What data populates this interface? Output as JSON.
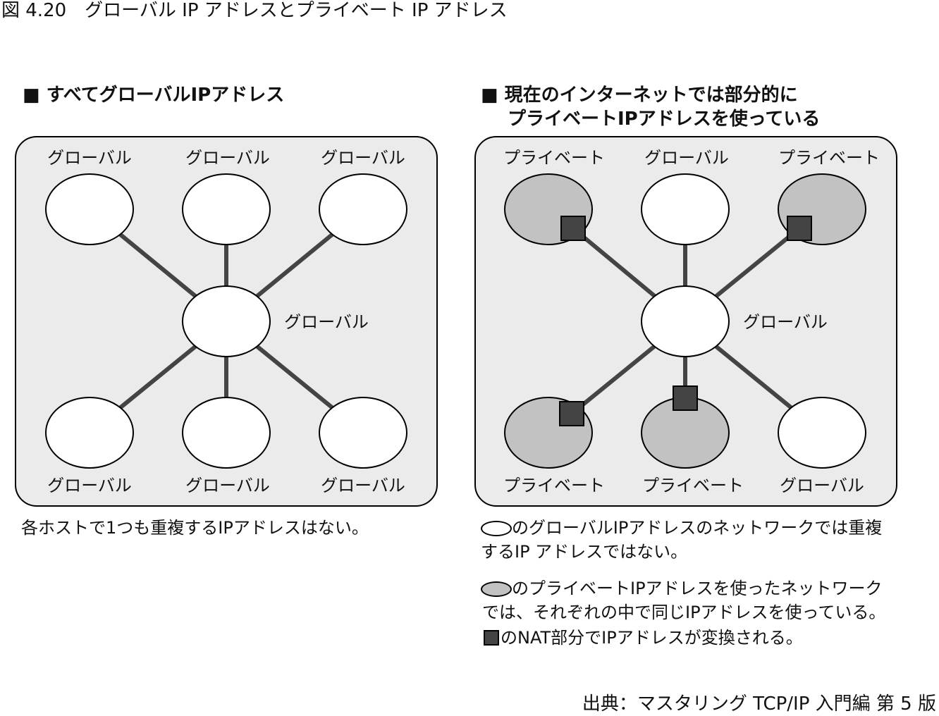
{
  "figure_title": "図 4.20　グローバル IP アドレスとプライベート IP アドレス",
  "left_panel": {
    "heading": "■ すべてグローバルIPアドレス",
    "hub_label": "グローバル",
    "top_labels": [
      "グローバル",
      "グローバル",
      "グローバル"
    ],
    "bottom_labels": [
      "グローバル",
      "グローバル",
      "グローバル"
    ],
    "note": "各ホストで1つも重複するIPアドレスはない。"
  },
  "right_panel": {
    "heading_line1": "■ 現在のインターネットでは部分的に",
    "heading_line2": "プライベートIPアドレスを使っている",
    "hub_label": "グローバル",
    "top_labels": [
      "プライベート",
      "グローバル",
      "プライベート"
    ],
    "bottom_labels": [
      "プライベート",
      "プライベート",
      "グローバル"
    ]
  },
  "legend": {
    "white_line1": "のグローバルIPアドレスのネットワークでは重複",
    "white_line2": "するIP アドレスではない。",
    "gray_line1": "のプライベートIPアドレスを使ったネットワーク",
    "gray_line2": "では、それぞれの中で同じIPアドレスを使っている。",
    "nat": "のNAT部分でIPアドレスが変換される。"
  },
  "colors": {
    "panel_bg": "#ebebeb",
    "global_fill": "#ffffff",
    "private_fill": "#c2c2c2",
    "nat_fill": "#444444",
    "link": "#444444"
  },
  "source": "出典：マスタリング TCP/IP 入門編 第 5 版"
}
